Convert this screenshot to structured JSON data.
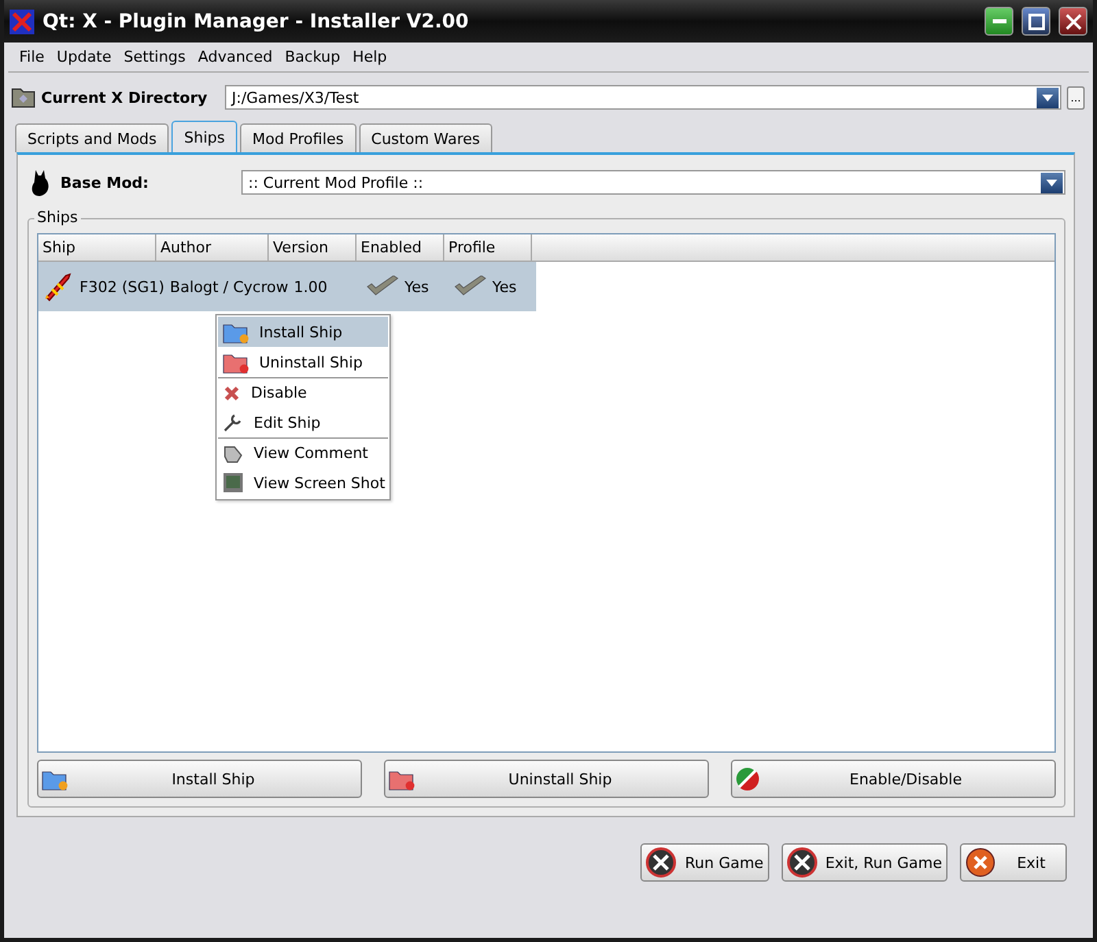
{
  "window": {
    "title": "Qt: X - Plugin Manager - Installer V2.00"
  },
  "menu": [
    "File",
    "Update",
    "Settings",
    "Advanced",
    "Backup",
    "Help"
  ],
  "directory": {
    "label": "Current X Directory",
    "value": "J:/Games/X3/Test",
    "browse": "..."
  },
  "tabs": [
    {
      "label": "Scripts and Mods",
      "selected": false
    },
    {
      "label": "Ships",
      "selected": true
    },
    {
      "label": "Mod Profiles",
      "selected": false
    },
    {
      "label": "Custom Wares",
      "selected": false
    }
  ],
  "base_mod": {
    "label": "Base Mod:",
    "value": ":: Current Mod Profile ::"
  },
  "ships": {
    "title": "Ships",
    "columns": [
      {
        "label": "Ship",
        "kind": "ship"
      },
      {
        "label": "Author",
        "kind": "text"
      },
      {
        "label": "Version",
        "kind": "text"
      },
      {
        "label": "Enabled",
        "kind": "check"
      },
      {
        "label": "Profile",
        "kind": "check"
      }
    ],
    "rows": [
      {
        "selected": true,
        "cells": [
          "F302 (SG1)",
          "Balogt / Cycrow",
          "1.00",
          "Yes",
          "Yes"
        ]
      }
    ]
  },
  "context_menu": [
    {
      "label": "Install Ship",
      "kind": "install",
      "selected": true
    },
    {
      "label": "Uninstall Ship",
      "kind": "uninstall",
      "selected": false
    },
    {
      "label": "Disable",
      "kind": "disable",
      "selected": false,
      "separator": true
    },
    {
      "label": "Edit Ship",
      "kind": "edit",
      "selected": false
    },
    {
      "label": "View Comment",
      "kind": "comment",
      "selected": false,
      "separator": true
    },
    {
      "label": "View Screen Shot",
      "kind": "screenshot",
      "selected": false
    }
  ],
  "actions": [
    {
      "label": "Install Ship",
      "kind": "install"
    },
    {
      "label": "Uninstall Ship",
      "kind": "uninstall"
    },
    {
      "label": "Enable/Disable",
      "kind": "toggle"
    }
  ],
  "footer": [
    {
      "label": "Run Game",
      "kind": "x3"
    },
    {
      "label": "Exit, Run Game",
      "kind": "x3"
    },
    {
      "label": "Exit",
      "kind": "exit"
    }
  ]
}
